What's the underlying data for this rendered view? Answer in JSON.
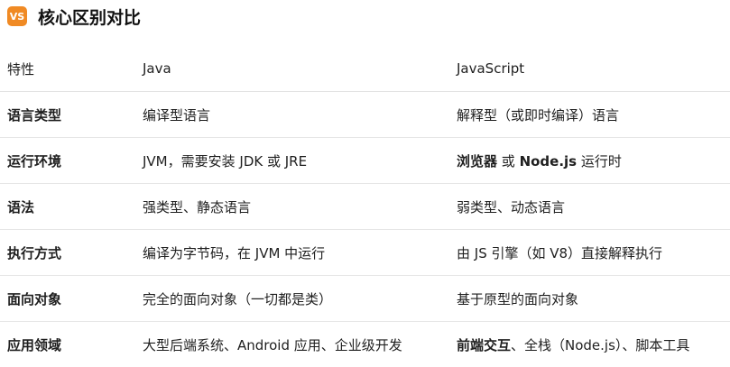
{
  "heading": {
    "badge": "VS",
    "title": "核心区别对比"
  },
  "table": {
    "headers": [
      "特性",
      "Java",
      "JavaScript"
    ],
    "rows": [
      {
        "feature": "语言类型",
        "java": "编译型语言",
        "js": "解释型（或即时编译）语言"
      },
      {
        "feature": "运行环境",
        "java": "JVM，需要安装 JDK 或 JRE",
        "js_bold": "浏览器",
        "js_mid": " 或 ",
        "js_bold2": "Node.js",
        "js_rest": " 运行时"
      },
      {
        "feature": "语法",
        "java": "强类型、静态语言",
        "js": "弱类型、动态语言"
      },
      {
        "feature": "执行方式",
        "java": "编译为字节码，在 JVM 中运行",
        "js": "由 JS 引擎（如 V8）直接解释执行"
      },
      {
        "feature": "面向对象",
        "java": "完全的面向对象（一切都是类）",
        "js": "基于原型的面向对象"
      },
      {
        "feature": "应用领域",
        "java": "大型后端系统、Android 应用、企业级开发",
        "js_bold": "前端交互",
        "js_rest": "、全栈（Node.js）、脚本工具"
      }
    ]
  }
}
